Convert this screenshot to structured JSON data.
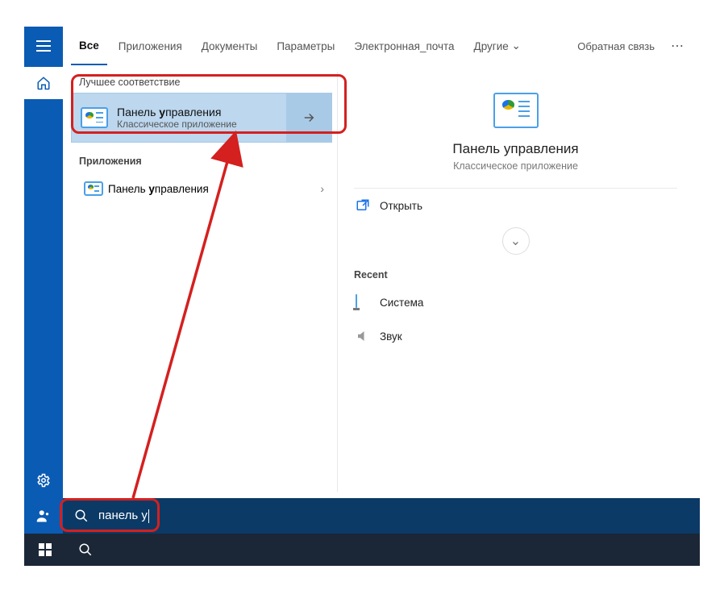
{
  "tabs": {
    "all": "Все",
    "apps": "Приложения",
    "documents": "Документы",
    "settings": "Параметры",
    "email": "Электронная_почта",
    "other": "Другие"
  },
  "feedback": "Обратная связь",
  "sections": {
    "best_match": "Лучшее соответствие",
    "apps": "Приложения"
  },
  "best_match": {
    "title_prefix": "Панель ",
    "title_hl": "у",
    "title_suffix": "правления",
    "subtitle": "Классическое приложение"
  },
  "apps_list": [
    {
      "title_prefix": "Панель ",
      "title_hl": "у",
      "title_suffix": "правления"
    }
  ],
  "detail": {
    "title": "Панель управления",
    "subtitle": "Классическое приложение",
    "open": "Открыть",
    "recent_label": "Recent",
    "recent": [
      {
        "label": "Система",
        "icon": "monitor"
      },
      {
        "label": "Звук",
        "icon": "speaker"
      }
    ]
  },
  "search": {
    "query": "панель у"
  }
}
